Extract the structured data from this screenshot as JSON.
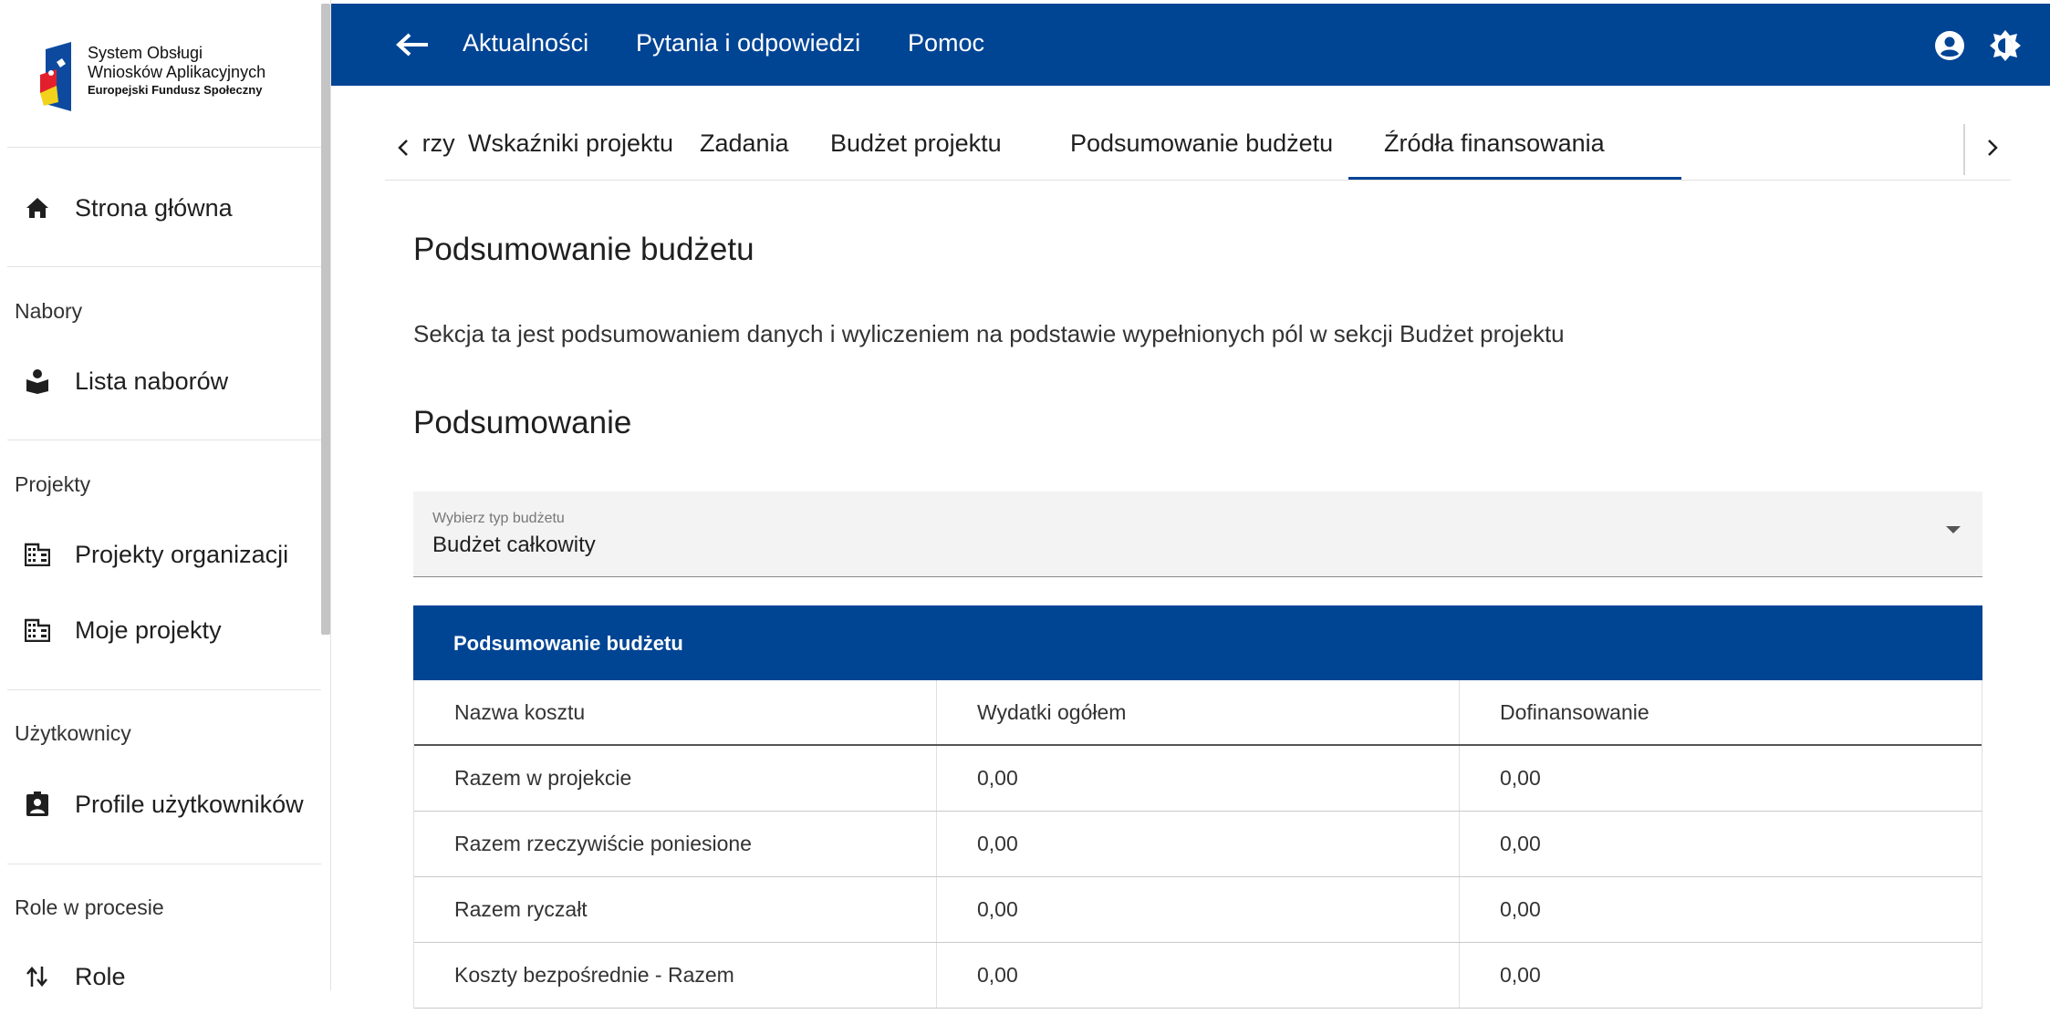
{
  "logo": {
    "line1": "System Obsługi",
    "line2": "Wniosków Aplikacyjnych",
    "line3": "Europejski Fundusz Społeczny"
  },
  "sidebar": {
    "home": {
      "label": "Strona główna",
      "icon": "home-icon"
    },
    "sections": [
      {
        "title": "Nabory",
        "items": [
          {
            "label": "Lista naborów",
            "icon": "book-reader-icon"
          }
        ]
      },
      {
        "title": "Projekty",
        "items": [
          {
            "label": "Projekty organizacji",
            "icon": "building-icon"
          },
          {
            "label": "Moje projekty",
            "icon": "building-icon"
          }
        ]
      },
      {
        "title": "Użytkownicy",
        "items": [
          {
            "label": "Profile użytkowników",
            "icon": "contact-badge-icon"
          }
        ]
      },
      {
        "title": "Role w procesie",
        "items": [
          {
            "label": "Role",
            "icon": "swap-vert-icon"
          }
        ]
      }
    ]
  },
  "topbar": {
    "links": [
      "Aktualności",
      "Pytania i odpowiedzi",
      "Pomoc"
    ],
    "icons": [
      "account-circle-icon",
      "brightness-icon"
    ]
  },
  "tabs": {
    "items": [
      "Partnerzy i realizatorzy",
      "Wskaźniki projektu",
      "Zadania",
      "Budżet projektu",
      "Podsumowanie budżetu",
      "Źródła finansowania"
    ],
    "active": "Podsumowanie budżetu"
  },
  "content": {
    "title": "Podsumowanie budżetu",
    "description": "Sekcja ta jest podsumowaniem danych i wyliczeniem na podstawie wypełnionych pól w sekcji Budżet projektu",
    "subtitle": "Podsumowanie",
    "select": {
      "label": "Wybierz typ budżetu",
      "value": "Budżet całkowity"
    },
    "table": {
      "title": "Podsumowanie budżetu",
      "columns": [
        "Nazwa kosztu",
        "Wydatki ogółem",
        "Dofinansowanie"
      ],
      "rows": [
        [
          "Razem w projekcie",
          "0,00",
          "0,00"
        ],
        [
          "Razem rzeczywiście poniesione",
          "0,00",
          "0,00"
        ],
        [
          "Razem ryczałt",
          "0,00",
          "0,00"
        ],
        [
          "Koszty bezpośrednie - Razem",
          "0,00",
          "0,00"
        ]
      ]
    }
  },
  "colors": {
    "primary": "#004494",
    "white": "#ffffff"
  }
}
